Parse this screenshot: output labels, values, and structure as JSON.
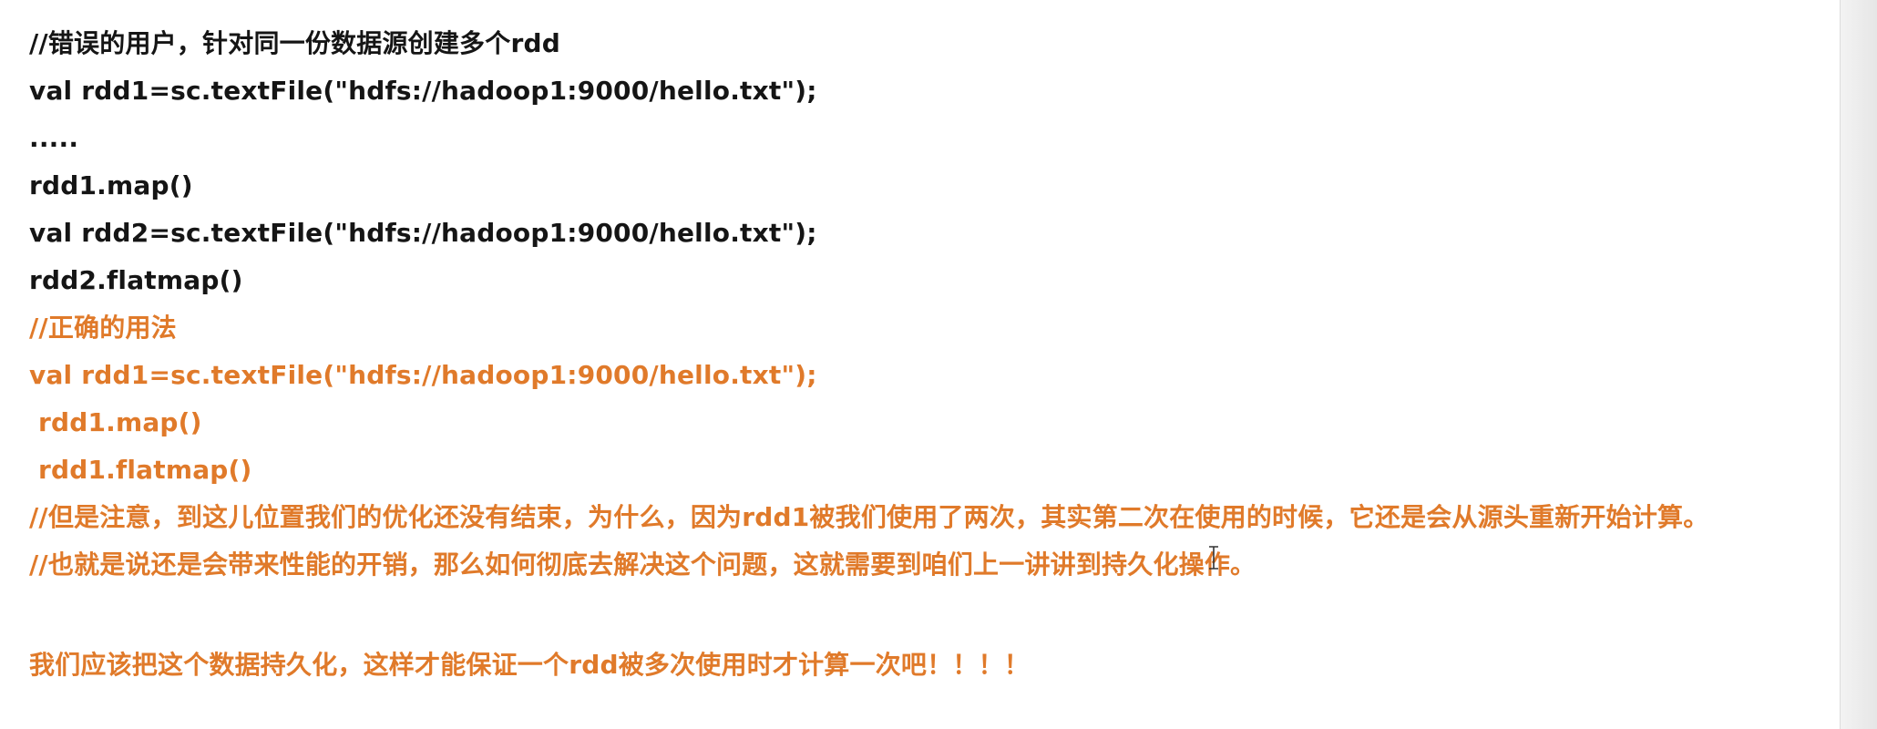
{
  "document": {
    "lines": [
      {
        "text": "//错误的用户，针对同一份数据源创建多个rdd",
        "color": "#151515"
      },
      {
        "text": "val rdd1=sc.textFile(\"hdfs://hadoop1:9000/hello.txt\");",
        "color": "#151515"
      },
      {
        "text": ".....",
        "color": "#151515"
      },
      {
        "text": "rdd1.map()",
        "color": "#151515"
      },
      {
        "text": "val rdd2=sc.textFile(\"hdfs://hadoop1:9000/hello.txt\");",
        "color": "#151515"
      },
      {
        "text": "rdd2.flatmap()",
        "color": "#151515"
      },
      {
        "text": "//正确的用法",
        "color": "#e07a2a"
      },
      {
        "text": "val rdd1=sc.textFile(\"hdfs://hadoop1:9000/hello.txt\");",
        "color": "#e07a2a"
      },
      {
        "text": " rdd1.map()",
        "color": "#e07a2a"
      },
      {
        "text": " rdd1.flatmap()",
        "color": "#e07a2a"
      },
      {
        "text": "//但是注意，到这儿位置我们的优化还没有结束，为什么，因为rdd1被我们使用了两次，其实第二次在使用的时候，它还是会从源头重新开始计算。",
        "color": "#e07a2a"
      },
      {
        "text": "//也就是说还是会带来性能的开销，那么如何彻底去解决这个问题，这就需要到咱们上一讲讲到持久化操作。",
        "color": "#e07a2a"
      },
      {
        "text": "我们应该把这个数据持久化，这样才能保证一个rdd被多次使用时才计算一次吧！！！！",
        "color": "#e07a2a"
      }
    ]
  },
  "cursor": {
    "icon": "text-cursor-icon"
  }
}
